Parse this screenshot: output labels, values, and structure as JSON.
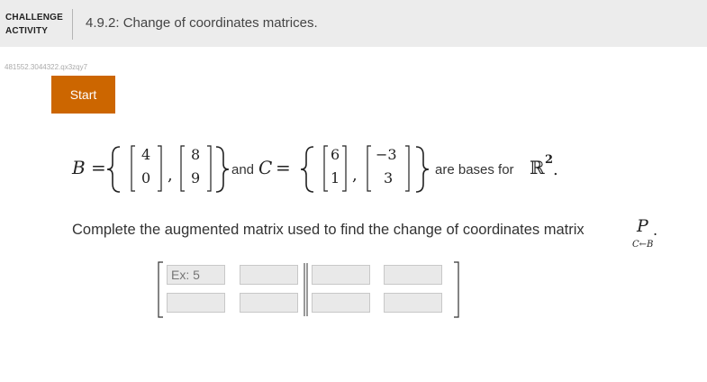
{
  "header": {
    "activity_label_line1": "CHALLENGE",
    "activity_label_line2": "ACTIVITY",
    "title": "4.9.2: Change of coordinates matrices."
  },
  "activity_id": "481552.3044322.qx3zqy7",
  "start_button": "Start",
  "problem": {
    "basis_b_symbol": "B",
    "equals": "=",
    "b_vector1": [
      "4",
      "0"
    ],
    "b_vector2": [
      "8",
      "9"
    ],
    "and_text": "and",
    "basis_c_symbol": "C",
    "c_vector1": [
      "6",
      "1"
    ],
    "c_vector2": [
      "−3",
      "3"
    ],
    "are_bases_text": "are bases for",
    "space_symbol": "ℝ",
    "space_power": "2",
    "period": "."
  },
  "instruction": {
    "text": "Complete the augmented matrix used to find the change of coordinates matrix",
    "matrix_symbol": "P",
    "subscript": "C←B",
    "period": "."
  },
  "augmented_matrix": {
    "placeholder": "Ex: 5",
    "rows": 2,
    "cols": 4
  }
}
